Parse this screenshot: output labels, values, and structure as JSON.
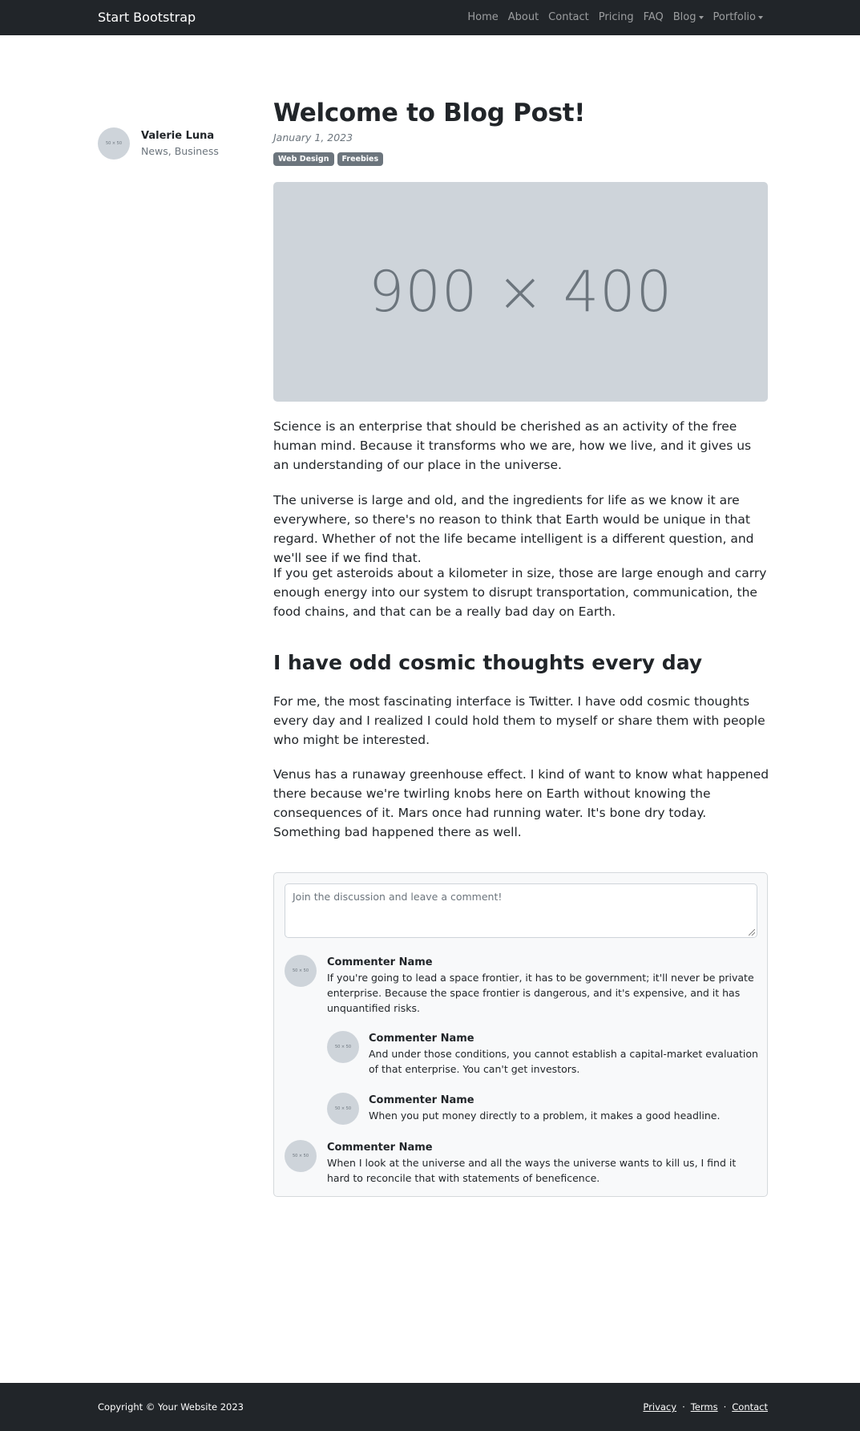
{
  "navbar": {
    "brand": "Start Bootstrap",
    "links": [
      "Home",
      "About",
      "Contact",
      "Pricing",
      "FAQ",
      "Blog",
      "Portfolio"
    ]
  },
  "author": {
    "avatar_label": "50 × 50",
    "name": "Valerie Luna",
    "categories": "News, Business"
  },
  "post": {
    "title": "Welcome to Blog Post!",
    "date": "January 1, 2023",
    "tags": [
      "Web Design",
      "Freebies"
    ],
    "hero_label": "900 × 400",
    "paragraphs": [
      "Science is an enterprise that should be cherished as an activity of the free human mind. Because it transforms who we are, how we live, and it gives us an understanding of our place in the universe.",
      "The universe is large and old, and the ingredients for life as we know it are everywhere, so there's no reason to think that Earth would be unique in that regard. Whether of not the life became intelligent is a different question, and we'll see if we find that.",
      "If you get asteroids about a kilometer in size, those are large enough and carry enough energy into our system to disrupt transportation, communication, the food chains, and that can be a really bad day on Earth.",
      "For me, the most fascinating interface is Twitter. I have odd cosmic thoughts every day and I realized I could hold them to myself or share them with people who might be interested.",
      "Venus has a runaway greenhouse effect. I kind of want to know what happened there because we're twirling knobs here on Earth without knowing the consequences of it. Mars once had running water. It's bone dry today. Something bad happened there as well."
    ],
    "subheading": "I have odd cosmic thoughts every day"
  },
  "comments": {
    "placeholder": "Join the discussion and leave a comment!",
    "avatar_label": "50 × 50",
    "items": [
      {
        "name": "Commenter Name",
        "text": "If you're going to lead a space frontier, it has to be government; it'll never be private enterprise. Because the space frontier is dangerous, and it's expensive, and it has unquantified risks."
      },
      {
        "name": "Commenter Name",
        "text": "And under those conditions, you cannot establish a capital-market evaluation of that enterprise. You can't get investors."
      },
      {
        "name": "Commenter Name",
        "text": "When you put money directly to a problem, it makes a good headline."
      },
      {
        "name": "Commenter Name",
        "text": "When I look at the universe and all the ways the universe wants to kill us, I find it hard to reconcile that with statements of beneficence."
      }
    ]
  },
  "footer": {
    "copyright": "Copyright © Your Website 2023",
    "links": [
      "Privacy",
      "Terms",
      "Contact"
    ],
    "separator": "·"
  }
}
